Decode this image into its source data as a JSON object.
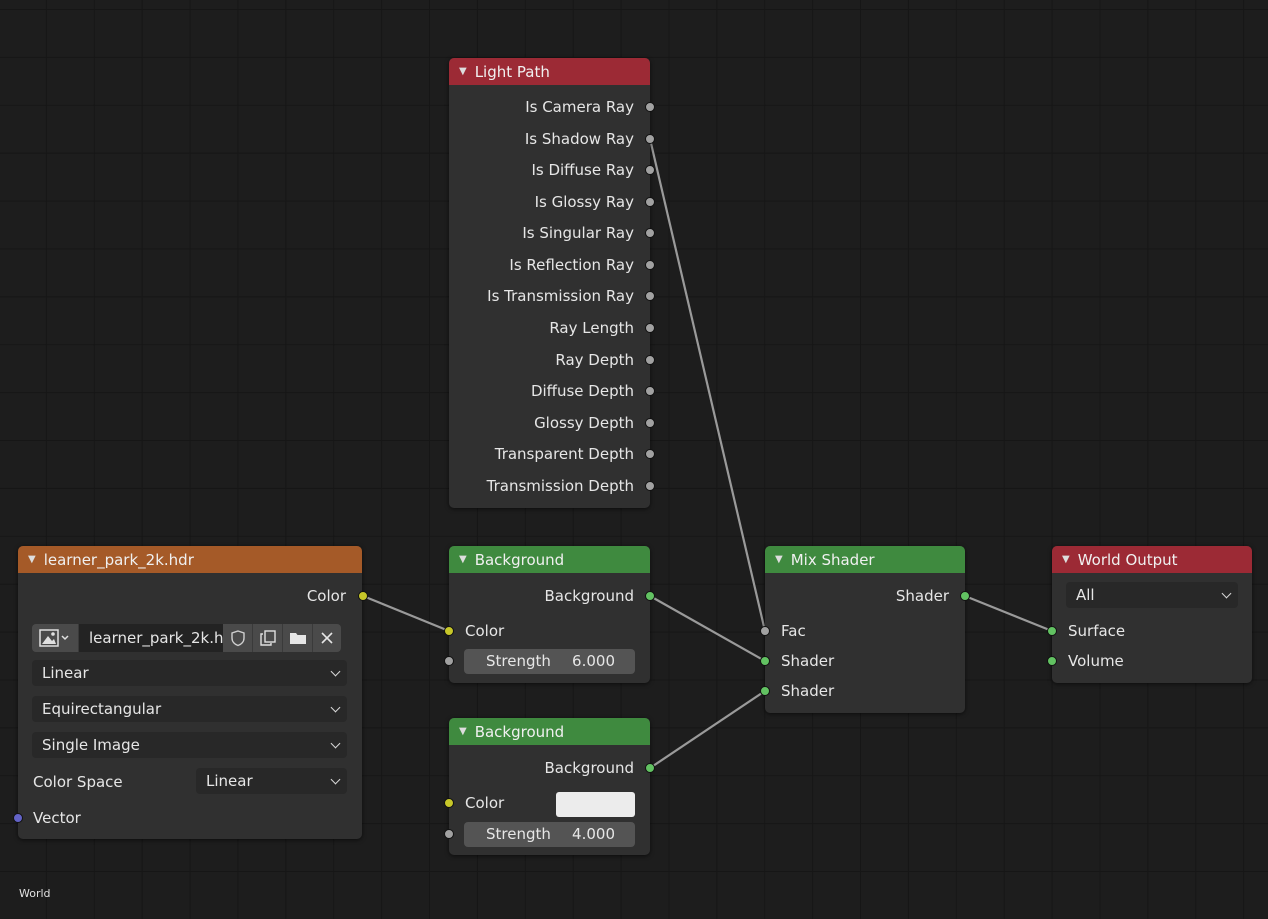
{
  "editor_label": "World",
  "colors": {
    "background": "#1d1d1d",
    "node_body": "#303030",
    "header_input": "#9c2a35",
    "header_shader": "#3f8a3f",
    "header_texture": "#a55a28",
    "socket_shader": "#62c262",
    "socket_color": "#c7c729",
    "socket_float": "#a1a1a1",
    "socket_vector": "#6363c7",
    "wire": "#b0b0b0"
  },
  "light_path": {
    "title": "Light Path",
    "outputs": [
      "Is Camera Ray",
      "Is Shadow Ray",
      "Is Diffuse Ray",
      "Is Glossy Ray",
      "Is Singular Ray",
      "Is Reflection Ray",
      "Is Transmission Ray",
      "Ray Length",
      "Ray Depth",
      "Diffuse Depth",
      "Glossy Depth",
      "Transparent Depth",
      "Transmission Depth"
    ]
  },
  "env_texture": {
    "title": "learner_park_2k.hdr",
    "output_color": "Color",
    "image_name": "learner_park_2k.h...",
    "interpolation": "Linear",
    "projection": "Equirectangular",
    "source": "Single Image",
    "color_space_label": "Color Space",
    "color_space_value": "Linear",
    "input_vector": "Vector"
  },
  "background1": {
    "title": "Background",
    "output": "Background",
    "input_color": "Color",
    "strength_label": "Strength",
    "strength_value": "6.000"
  },
  "background2": {
    "title": "Background",
    "output": "Background",
    "input_color": "Color",
    "strength_label": "Strength",
    "strength_value": "4.000"
  },
  "mix_shader": {
    "title": "Mix Shader",
    "output": "Shader",
    "input_fac": "Fac",
    "input_shader1": "Shader",
    "input_shader2": "Shader"
  },
  "world_output": {
    "title": "World Output",
    "target": "All",
    "input_surface": "Surface",
    "input_volume": "Volume"
  },
  "links": [
    {
      "from": "light_path.Is Shadow Ray",
      "to": "mix_shader.Fac"
    },
    {
      "from": "env_texture.Color",
      "to": "background1.Color"
    },
    {
      "from": "background1.Background",
      "to": "mix_shader.Shader"
    },
    {
      "from": "background2.Background",
      "to": "mix_shader.Shader"
    },
    {
      "from": "mix_shader.Shader",
      "to": "world_output.Surface"
    }
  ]
}
